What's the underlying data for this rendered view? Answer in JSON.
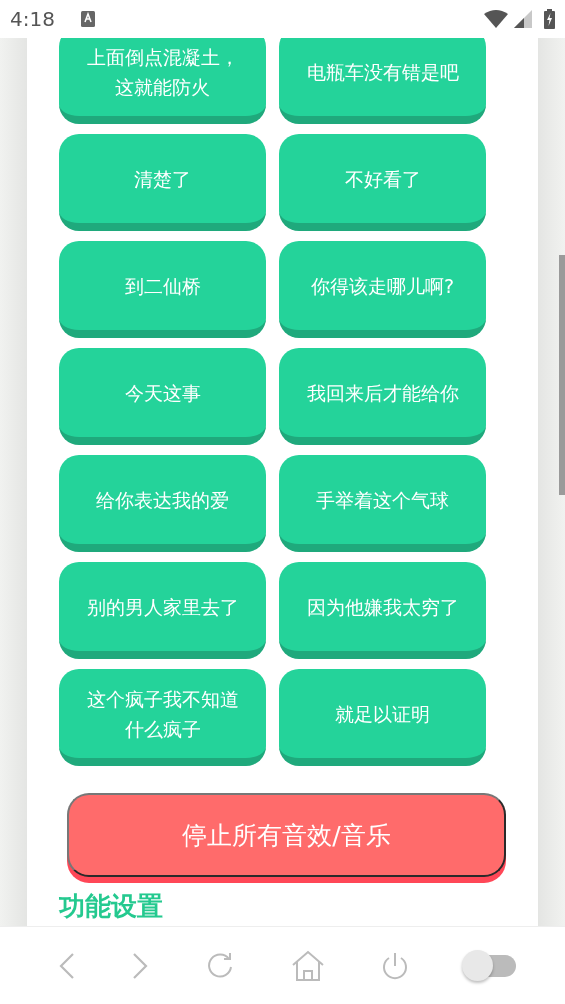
{
  "status_bar": {
    "time": "4:18"
  },
  "sound_buttons": [
    {
      "label": "上面倒点混凝土，这就能防火"
    },
    {
      "label": "电瓶车没有错是吧"
    },
    {
      "label": "清楚了"
    },
    {
      "label": "不好看了"
    },
    {
      "label": "到二仙桥"
    },
    {
      "label": "你得该走哪儿啊?"
    },
    {
      "label": "今天这事"
    },
    {
      "label": "我回来后才能给你"
    },
    {
      "label": "给你表达我的爱"
    },
    {
      "label": "手举着这个气球"
    },
    {
      "label": "别的男人家里去了"
    },
    {
      "label": "因为他嫌我太穷了"
    },
    {
      "label": "这个疯子我不知道什么疯子"
    },
    {
      "label": "就足以证明"
    }
  ],
  "stop_button": {
    "label": "停止所有音效/音乐"
  },
  "section_heading": "功能设置",
  "nav_bar": {
    "toggle": {
      "on": false
    }
  }
}
